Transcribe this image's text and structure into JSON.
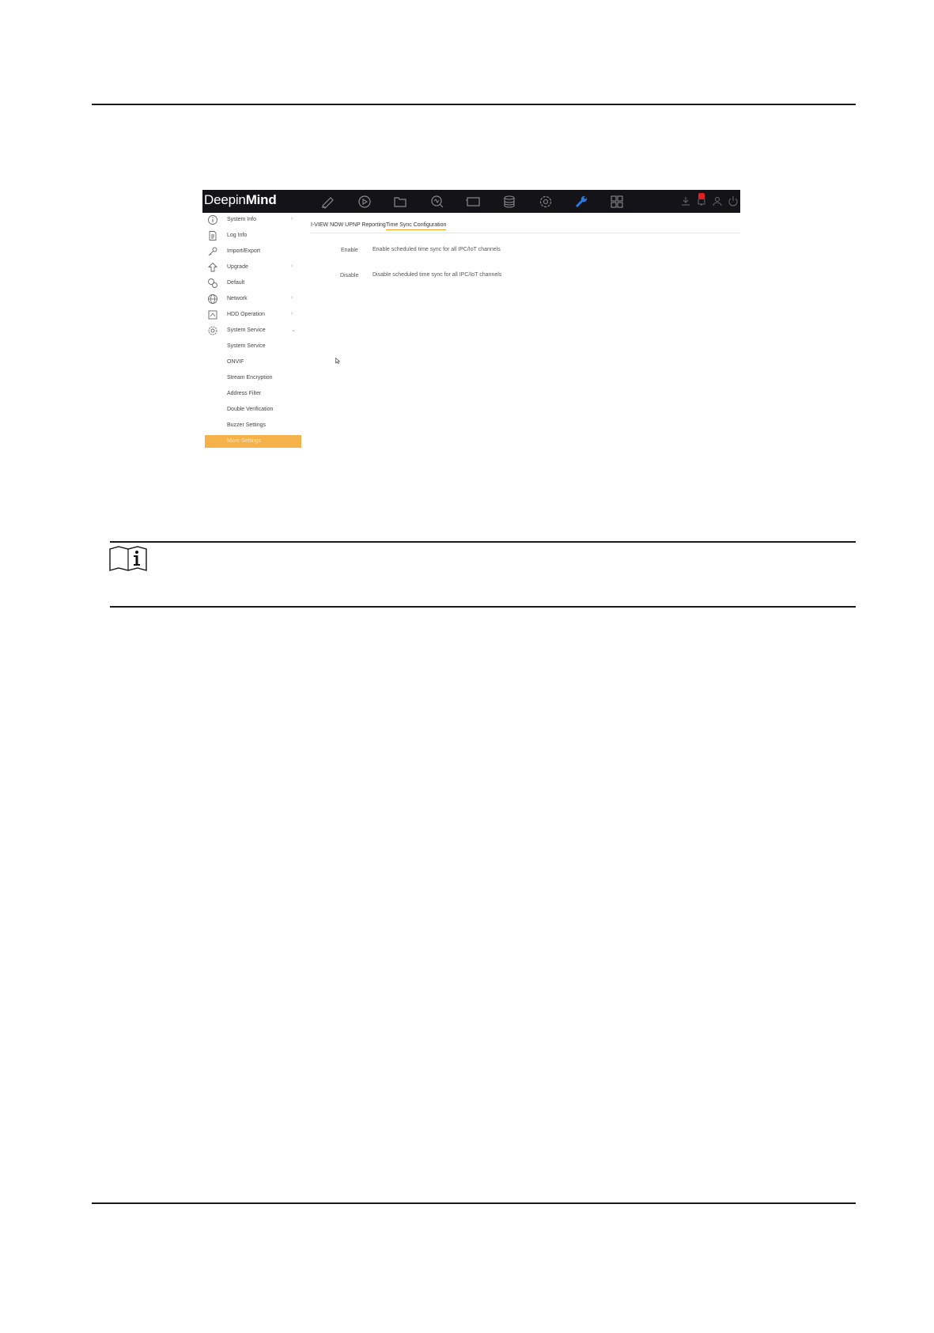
{
  "app": {
    "logo_part1": "Deepin",
    "logo_part2": "Mind",
    "nav_icons": [
      "live-view-icon",
      "playback-icon",
      "file-folder-icon",
      "smart-analysis-icon",
      "display-icon",
      "storage-icon",
      "settings-gear-icon",
      "maintenance-wrench-icon",
      "more-grid-icon"
    ],
    "status_icons": [
      "download-icon",
      "bell-alarm-icon",
      "user-icon",
      "power-icon"
    ]
  },
  "sidebar": {
    "items": [
      {
        "label": "System Info",
        "icon": "info-icon",
        "chevron": "›"
      },
      {
        "label": "Log Info",
        "icon": "document-icon",
        "chevron": ""
      },
      {
        "label": "Import/Export",
        "icon": "key-icon",
        "chevron": ""
      },
      {
        "label": "Upgrade",
        "icon": "upgrade-icon",
        "chevron": "›"
      },
      {
        "label": "Default",
        "icon": "default-icon",
        "chevron": ""
      },
      {
        "label": "Network",
        "icon": "globe-icon",
        "chevron": "›"
      },
      {
        "label": "HDD Operation",
        "icon": "hdd-icon",
        "chevron": "›"
      },
      {
        "label": "System Service",
        "icon": "service-icon",
        "chevron": "⌄"
      }
    ],
    "sub_items": [
      {
        "label": "System Service"
      },
      {
        "label": "ONVIF"
      },
      {
        "label": "Stream Encryption"
      },
      {
        "label": "Address Filter"
      },
      {
        "label": "Double Verification"
      },
      {
        "label": "Buzzer Settings"
      }
    ],
    "active_item": "More Settings"
  },
  "content": {
    "tabs": [
      "I-VIEW NOW UPNP Reporting",
      "Time Sync Configuration"
    ],
    "rows": [
      {
        "button": "Enable",
        "description": "Enable scheduled time sync for all IPC/IoT channels"
      },
      {
        "button": "Disable",
        "description": "Disable scheduled time sync for all IPC/IoT channels"
      }
    ]
  },
  "colors": {
    "topbar": "#141418",
    "accent": "#f5b24a",
    "active_nav": "#2a7be4",
    "alarm_badge": "#e02020"
  },
  "note_icon": "note-info-icon"
}
